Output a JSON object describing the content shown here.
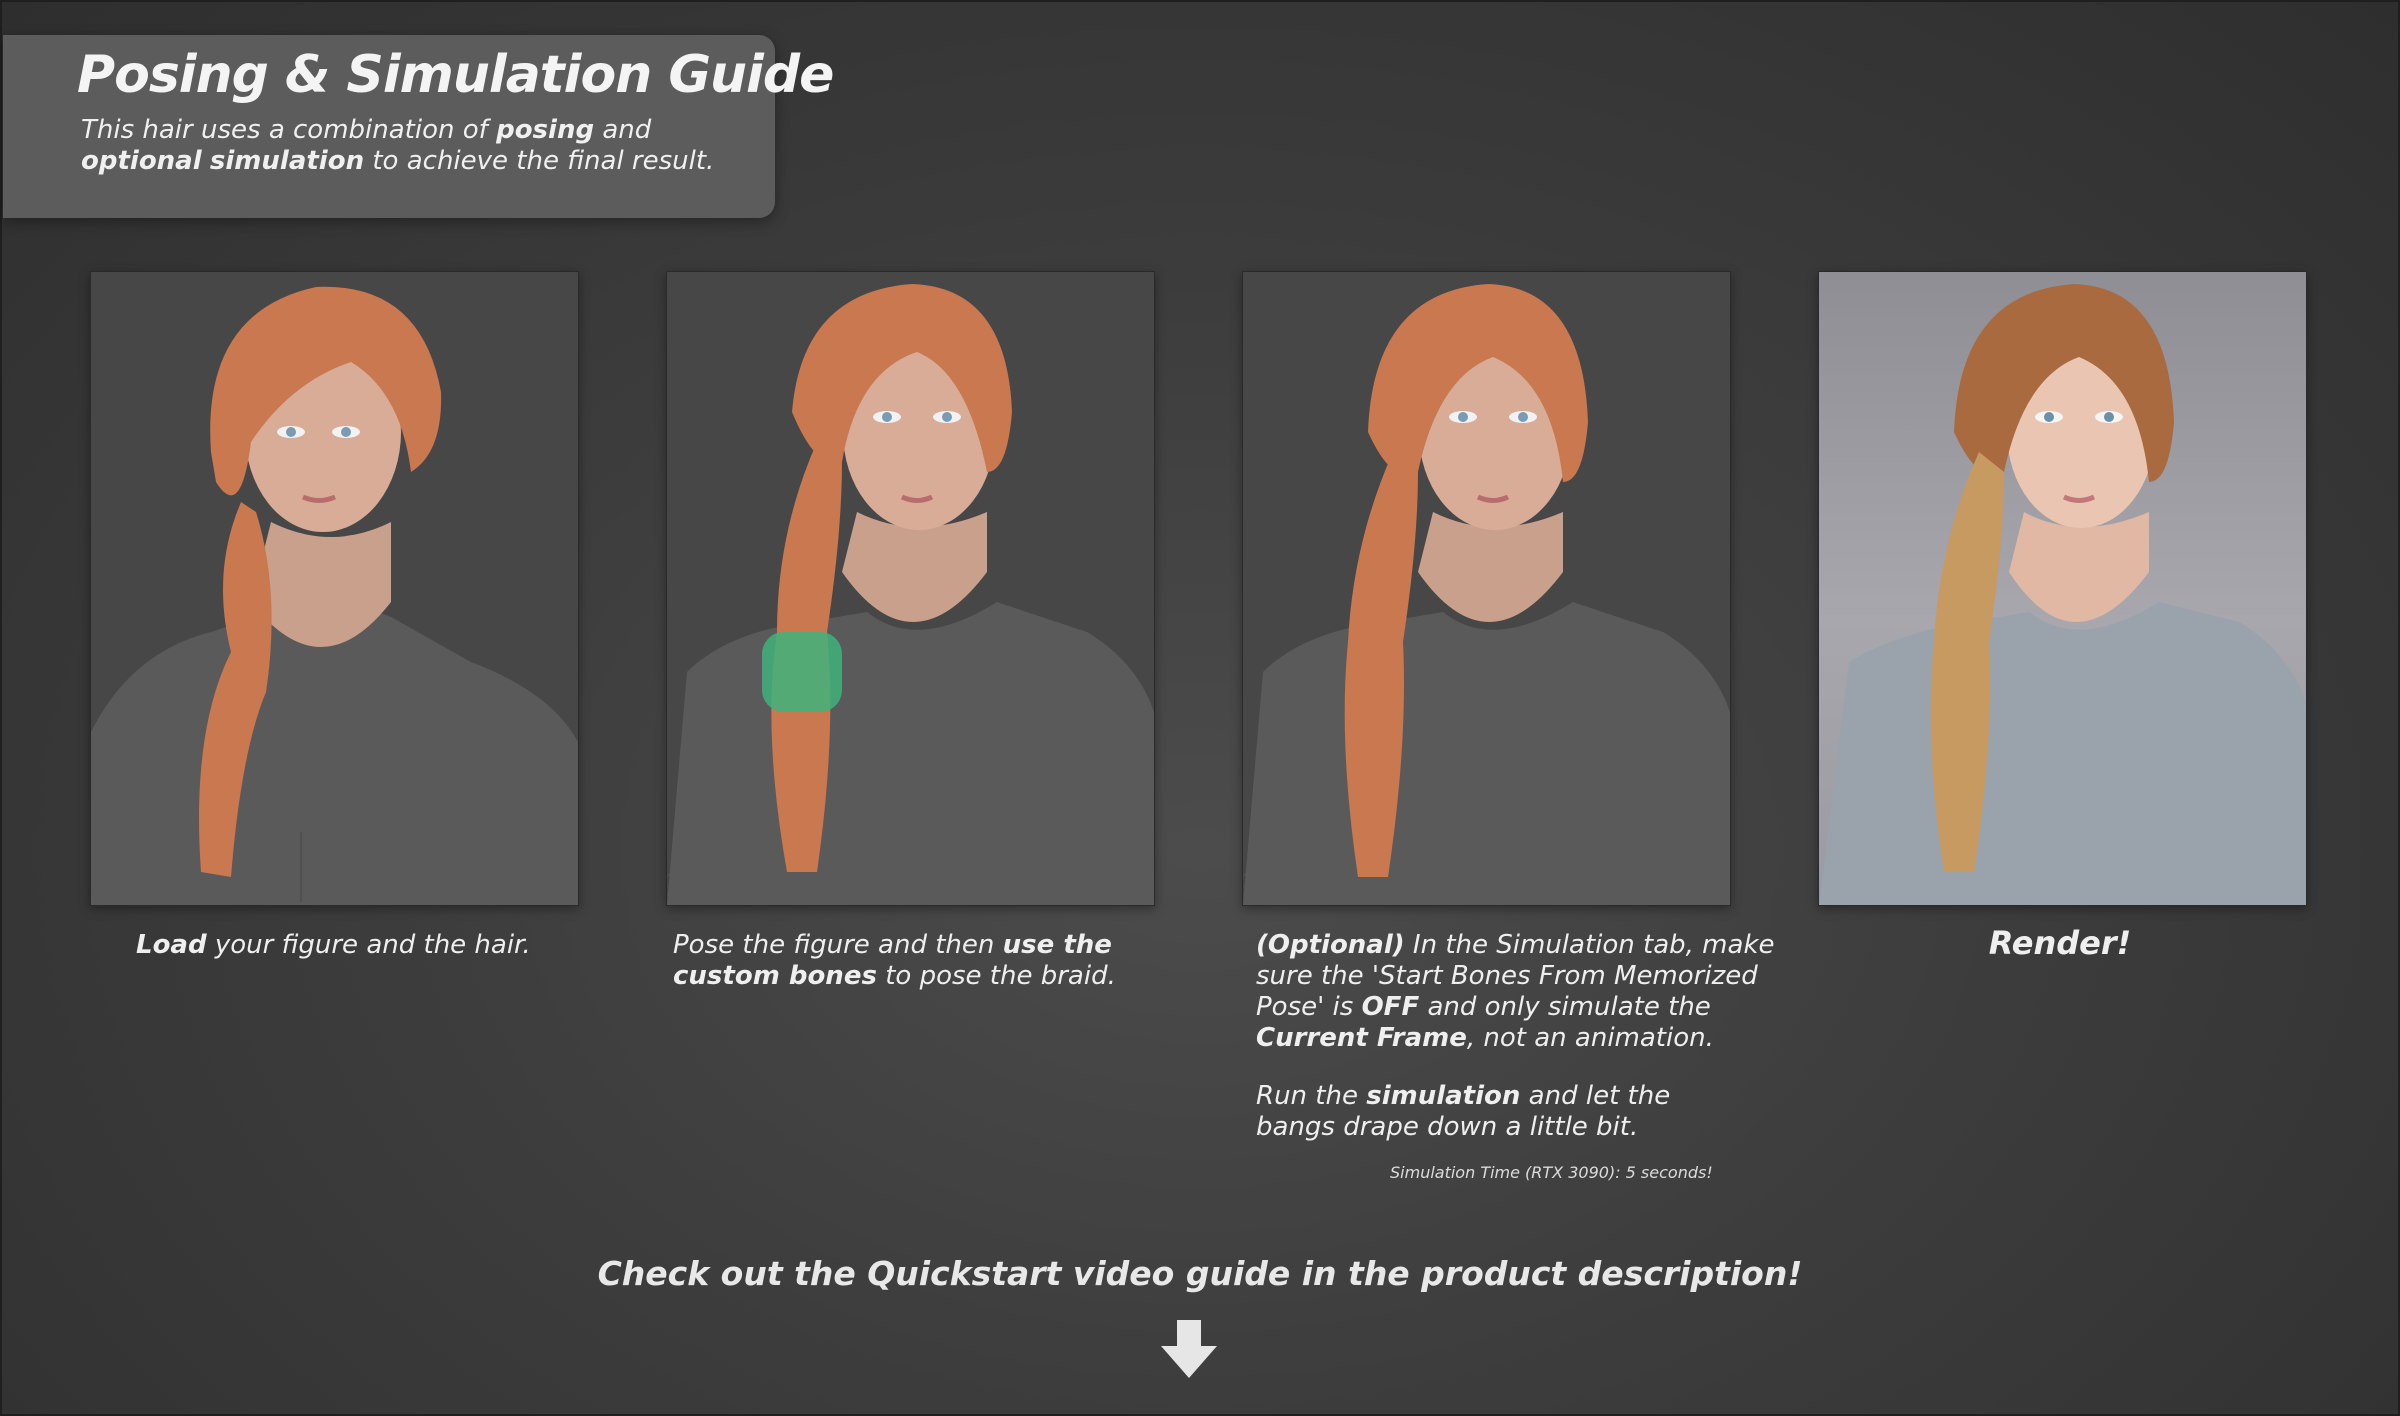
{
  "header": {
    "title": "Posing & Simulation Guide",
    "subtitle_parts": [
      "This hair uses a combination of ",
      "posing",
      " and ",
      "optional",
      " ",
      "simulation",
      " to achieve the final result."
    ]
  },
  "steps": [
    {
      "caption_parts": [
        "Load",
        " your figure and the hair."
      ]
    },
    {
      "caption_parts": [
        "Pose the figure and then ",
        "use the",
        " ",
        "custom bones",
        " to pose the braid."
      ]
    },
    {
      "caption_parts": [
        "(Optional)",
        " In the Simulation tab, make sure the 'Start Bones From Memorized Pose' is ",
        "OFF",
        " and only simulate the ",
        "Current Frame",
        ", not an animation."
      ],
      "caption2_parts": [
        "Run the ",
        "simulation",
        " and let the bangs drape down a little bit."
      ],
      "note": "Simulation Time (RTX 3090): 5 seconds!"
    },
    {
      "caption": "Render!"
    }
  ],
  "cta": "Check out the Quickstart video guide in the product description!",
  "colors": {
    "background": "#3d3d3d",
    "title_box": "#5c5c5c",
    "hair_viewport": "#c9784f",
    "hair_render": "#b9834f",
    "bone_highlight": "#3fb37a",
    "shirt_viewport": "#5a5a5a",
    "shirt_render": "#9aa3ab"
  },
  "icons": [
    "down-arrow-icon"
  ]
}
